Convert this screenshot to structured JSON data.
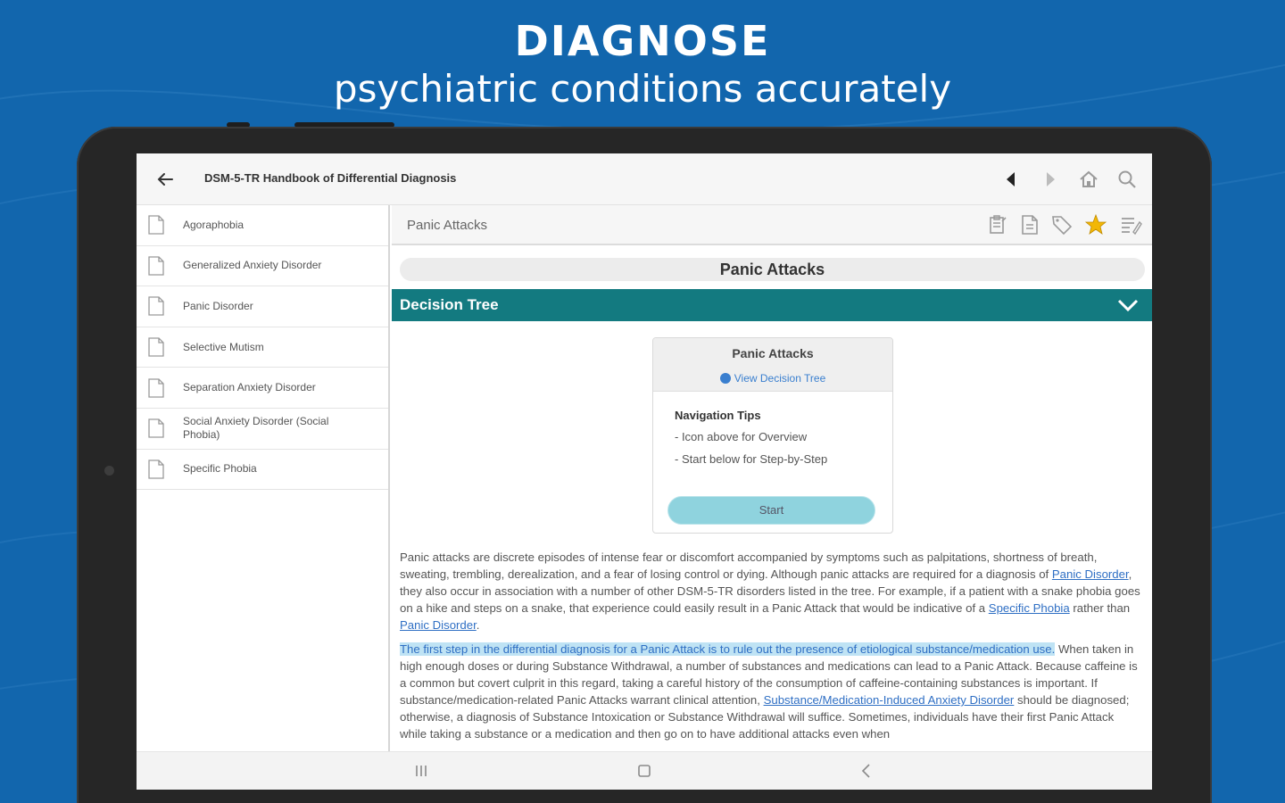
{
  "hero": {
    "title": "DIAGNOSE",
    "subtitle": "psychiatric conditions accurately"
  },
  "app": {
    "title": "DSM-5-TR Handbook of Differential Diagnosis",
    "toolbar_icons": [
      "back-arrow-icon",
      "previous-icon",
      "next-icon",
      "home-icon",
      "search-icon"
    ]
  },
  "sidebar": {
    "items": [
      {
        "label": "Agoraphobia"
      },
      {
        "label": "Generalized Anxiety Disorder"
      },
      {
        "label": "Panic Disorder"
      },
      {
        "label": "Selective Mutism"
      },
      {
        "label": "Separation Anxiety Disorder"
      },
      {
        "label": "Social Anxiety Disorder (Social Phobia)"
      },
      {
        "label": "Specific Phobia"
      }
    ]
  },
  "content": {
    "breadcrumb": "Panic Attacks",
    "header_icons": [
      "clipboard-icon",
      "document-icon",
      "tag-icon",
      "star-icon",
      "notes-icon"
    ],
    "title": "Panic Attacks",
    "section": "Decision Tree",
    "card": {
      "title": "Panic Attacks",
      "link": "View Decision Tree",
      "tips_heading": "Navigation Tips",
      "tip1": "- Icon above for Overview",
      "tip2": "- Start below for Step-by-Step",
      "start": "Start"
    },
    "p1": {
      "t1": "Panic attacks are discrete episodes of intense fear or discomfort accompanied by symptoms such as palpitations, shortness of breath, sweating, trembling, derealization, and a fear of losing control or dying. Although panic attacks are required for a diagnosis of ",
      "l1": "Panic Disorder",
      "t2": ", they also occur in association with a number of other DSM-5-TR disorders listed in the tree. For example, if a patient with a snake phobia goes on a hike and steps on a snake, that experience could easily result in a Panic Attack that would be indicative of a ",
      "l2": "Specific Phobia",
      "t3": " rather than ",
      "l3": "Panic Disorder",
      "t4": "."
    },
    "p2": {
      "hl": "The first step in the differential diagnosis for a Panic Attack is to rule out the presence of etiological substance/medication use.",
      "t1": " When taken in high enough doses or during Substance Withdrawal, a number of substances and medications can lead to a Panic Attack. Because caffeine is a common but covert culprit in this regard, taking a careful history of the consumption of caffeine-containing substances is important. If substance/medication-related Panic Attacks warrant clinical attention, ",
      "l1": "Substance/Medication-Induced Anxiety Disorder",
      "t2": " should be diagnosed; otherwise, a diagnosis of Substance Intoxication or Substance Withdrawal will suffice. Sometimes, individuals have their first Panic Attack while taking a substance or a medication and then go on to have additional attacks even when"
    }
  },
  "colors": {
    "background": "#1266ad",
    "section_bar": "#137a80",
    "start_button": "#8fd3de",
    "link": "#2f6fc4",
    "star": "#f2b705"
  }
}
